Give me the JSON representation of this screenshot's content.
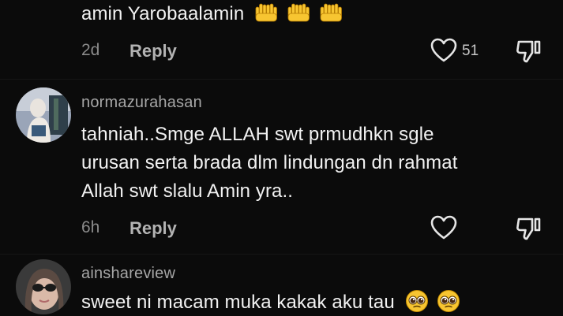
{
  "comments": [
    {
      "text_lines": [
        "amin Yarobaalamin"
      ],
      "emoji": [
        "raised-hands-icon",
        "raised-hands-icon",
        "raised-hands-icon"
      ],
      "time": "2d",
      "reply_label": "Reply",
      "like_count": "51"
    },
    {
      "username": "normazurahasan",
      "text_lines": [
        "tahniah..Smge ALLAH swt prmudhkn sgle",
        "urusan serta brada dlm lindungan dn rahmat",
        "Allah swt slalu Amin yra.."
      ],
      "time": "6h",
      "reply_label": "Reply"
    },
    {
      "username": "ainshareview",
      "text_lines": [
        "sweet ni macam muka kakak aku tau"
      ],
      "emoji": [
        "pleading-face-icon",
        "pleading-face-icon"
      ]
    }
  ],
  "colors": {
    "background": "#0b0b0b",
    "text": "#f2f2f2",
    "muted": "#8a8a8a",
    "emoji_yellow": "#f7c531"
  }
}
